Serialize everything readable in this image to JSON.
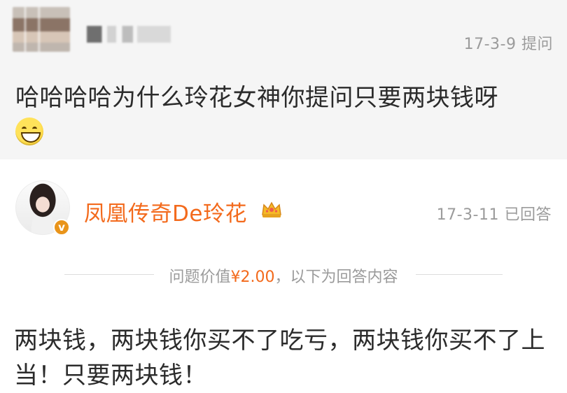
{
  "question": {
    "asker_name": "",
    "date": "17-3-9",
    "action": "提问",
    "text": "哈哈哈哈为什么玲花女神你提问只要两块钱呀",
    "emoji": "grinning-face-emoji"
  },
  "answer": {
    "name": "凤凰传奇De玲花",
    "verified_badge": "v",
    "crown_icon": "crown-icon",
    "date": "17-3-11",
    "status": "已回答",
    "divider_prefix": "问题价值",
    "price": "¥2.00",
    "divider_suffix": "，以下为回答内容",
    "text": "两块钱，两块钱你买不了吃亏，两块钱你买不了上当！只要两块钱！"
  },
  "colors": {
    "accent": "#f36a1c",
    "meta_gray": "#9b9b9b",
    "question_bg": "#f5f5f5"
  }
}
